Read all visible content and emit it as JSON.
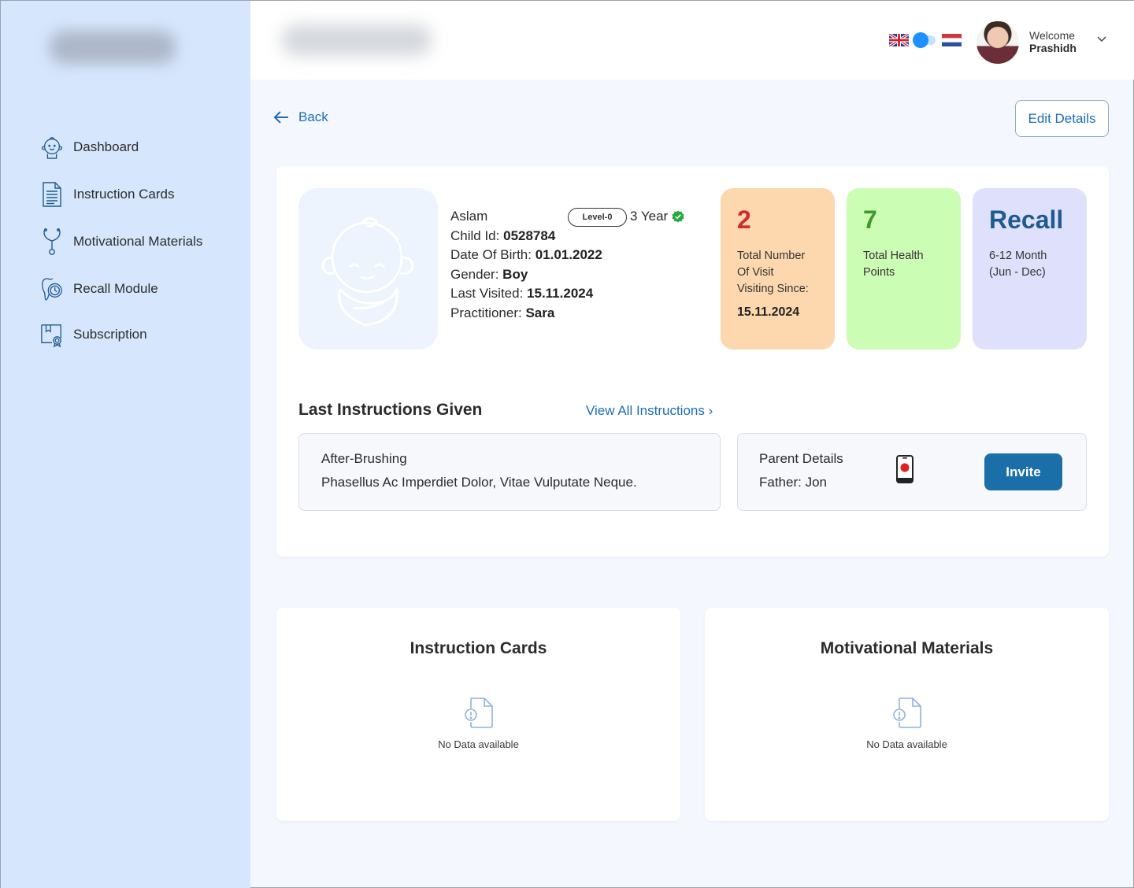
{
  "sidebar": {
    "items": [
      {
        "label": "Dashboard",
        "icon": "baby-face-icon"
      },
      {
        "label": "Instruction Cards",
        "icon": "document-icon"
      },
      {
        "label": "Motivational Materials",
        "icon": "stethoscope-icon"
      },
      {
        "label": "Recall Module",
        "icon": "tooth-clock-icon"
      },
      {
        "label": "Subscription",
        "icon": "certificate-icon"
      }
    ]
  },
  "header": {
    "welcome": "Welcome",
    "user_name": "Prashidh"
  },
  "actions": {
    "back": "Back",
    "edit_details": "Edit Details"
  },
  "child": {
    "name": "Aslam",
    "level": "Level-0",
    "age": "3 Year",
    "child_id_label": "Child Id:",
    "child_id": "0528784",
    "dob_label": "Date Of Birth:",
    "dob": "01.01.2022",
    "gender_label": "Gender:",
    "gender": "Boy",
    "last_visited_label": "Last Visited:",
    "last_visited": "15.11.2024",
    "practitioner_label": "Practitioner:",
    "practitioner": "Sara"
  },
  "stats": {
    "visits": {
      "value": "2",
      "line1": "Total Number",
      "line2": "Of Visit",
      "line3": "Visiting Since:",
      "since": "15.11.2024",
      "bg": "#fdd8ae",
      "color": "#d12b2b"
    },
    "health": {
      "value": "7",
      "line1": "Total Health",
      "line2": "Points",
      "bg": "#ccfdb4",
      "color": "#3b9b2b"
    },
    "recall": {
      "value": "Recall",
      "line1": "6-12 Month",
      "line2": "(Jun - Dec)",
      "bg": "#dfe1fc",
      "color": "#1f5b8f"
    }
  },
  "instructions": {
    "title": "Last Instructions Given",
    "view_all": "View All Instructions",
    "item_title": "After-Brushing",
    "item_desc": "Phasellus Ac Imperdiet Dolor, Vitae Vulputate Neque."
  },
  "parent": {
    "title": "Parent Details",
    "father": "Father: Jon",
    "invite": "Invite"
  },
  "cards": {
    "instruction_cards": {
      "title": "Instruction Cards",
      "empty": "No Data available"
    },
    "motivational_materials": {
      "title": "Motivational Materials",
      "empty": "No Data available"
    }
  },
  "colors": {
    "accent": "#1a6dbb",
    "sidebar_bg": "#d6e6fd",
    "page_bg": "#f4f8fe",
    "invite_bg": "#1a6fa8"
  }
}
